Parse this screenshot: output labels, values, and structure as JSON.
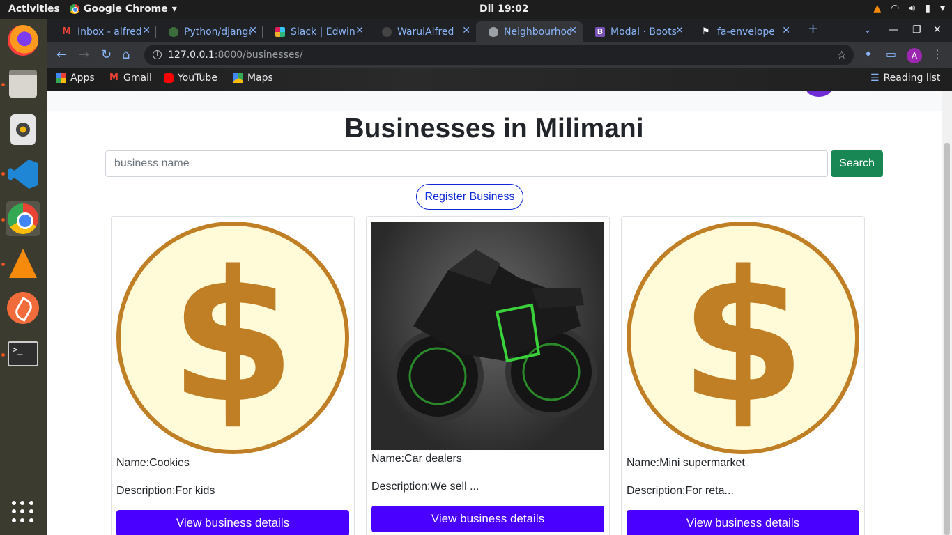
{
  "system": {
    "activities": "Activities",
    "app_name": "Google Chrome",
    "clock": "Dil 19:02"
  },
  "browser": {
    "tabs": [
      {
        "title": "Inbox - alfred",
        "favicon": "gmail-icon",
        "color": "#ea4335"
      },
      {
        "title": "Python/django",
        "favicon": "python-icon",
        "color": "#3c6e3c"
      },
      {
        "title": "Slack | Edwin",
        "favicon": "slack-icon",
        "color": "#e01e5a"
      },
      {
        "title": "WaruiAlfred",
        "favicon": "github-icon",
        "color": "#444444"
      },
      {
        "title": "Neighbourhood",
        "favicon": "globe-icon",
        "color": "#9aa0a6"
      },
      {
        "title": "Modal · Bootstrap",
        "favicon": "bootstrap-icon",
        "color": "#7952b3"
      },
      {
        "title": "fa-envelope",
        "favicon": "flag-icon",
        "color": "#ffffff"
      }
    ],
    "url_host": "127.0.0.1",
    "url_path": ":8000/businesses/",
    "avatar_letter": "A",
    "bookmarks": [
      {
        "label": "Apps"
      },
      {
        "label": "Gmail"
      },
      {
        "label": "YouTube"
      },
      {
        "label": "Maps"
      }
    ],
    "reading_list": "Reading list"
  },
  "page": {
    "title": "Businesses in Milimani",
    "search_placeholder": "business name",
    "search_label": "Search",
    "register_label": "Register Business",
    "businesses": [
      {
        "name": "Name:Cookies",
        "description": "Description:For kids",
        "button": "View business details",
        "image": "dollar-coin"
      },
      {
        "name": "Name:Car dealers",
        "description": "Description:We sell ...",
        "button": "View business details",
        "image": "motorcycle-photo"
      },
      {
        "name": "Name:Mini supermarket",
        "description": "Description:For reta...",
        "button": "View business details",
        "image": "dollar-coin"
      }
    ]
  }
}
